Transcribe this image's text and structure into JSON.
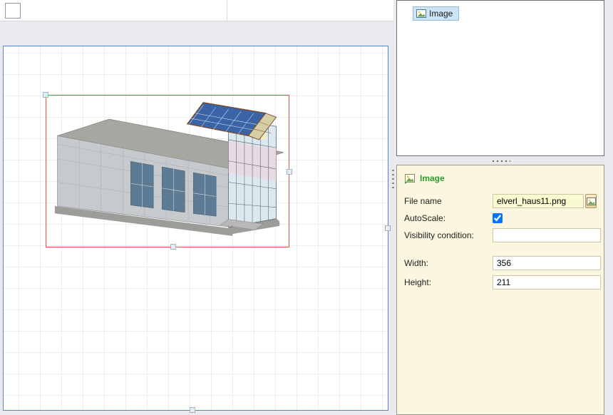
{
  "toolbox": {
    "image_item_label": "Image"
  },
  "props": {
    "title": "Image",
    "file_name_label": "File name",
    "file_name_value": "elverl_haus11.png",
    "autoscale_label": "AutoScale:",
    "autoscale_checked": true,
    "visibility_label": "Visibility condition:",
    "visibility_value": "",
    "width_label": "Width:",
    "width_value": "356",
    "height_label": "Height:",
    "height_value": "211"
  },
  "colors": {
    "accent_green": "#2e9d2e",
    "selection_red": "#e0544a",
    "highlight_blue": "#cde4f7",
    "panel_cream": "#fbf6df"
  }
}
